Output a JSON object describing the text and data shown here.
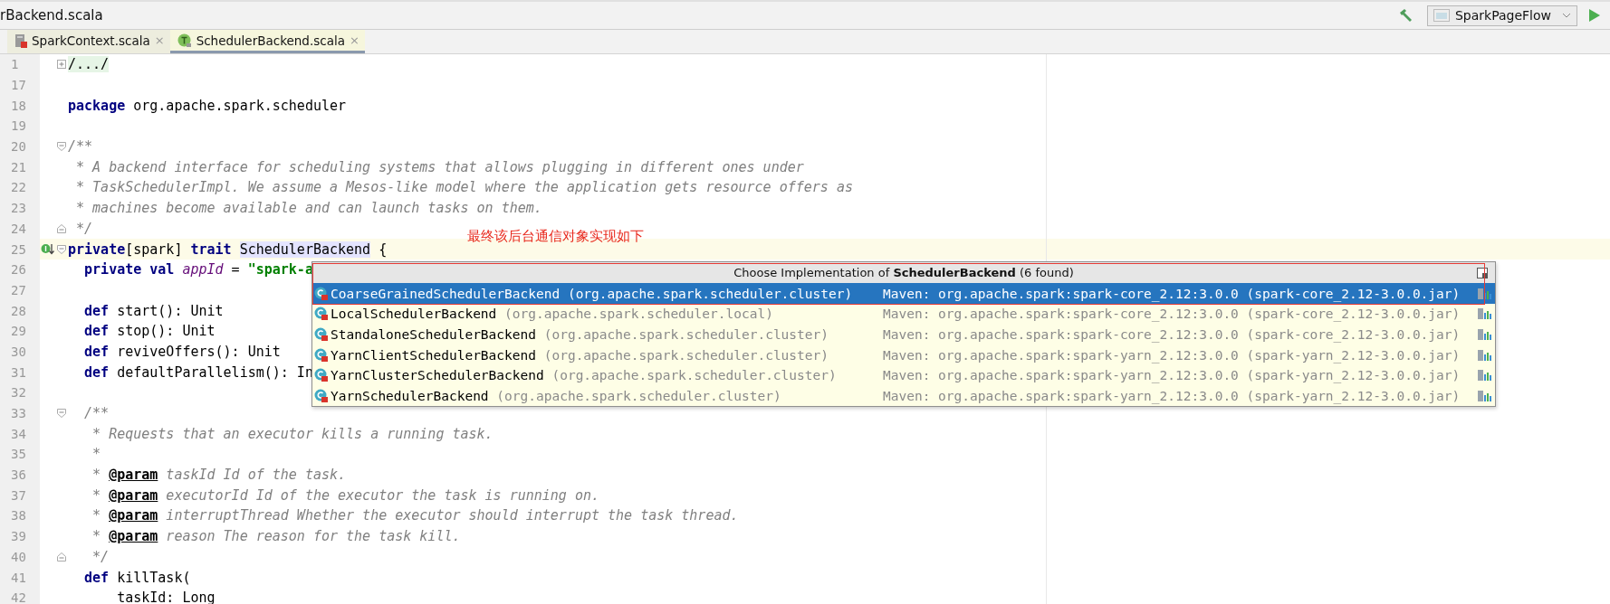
{
  "title_bar": {
    "title": "rBackend.scala",
    "run_config": "SparkPageFlow"
  },
  "tabs": [
    {
      "label": "SparkContext.scala",
      "close": "×",
      "kind": "scala",
      "selected": false
    },
    {
      "label": "SchedulerBackend.scala",
      "close": "×",
      "kind": "trait",
      "selected": true
    }
  ],
  "editor": {
    "lines": [
      {
        "number": "1",
        "current": false,
        "fold": {
          "kind": "collapsed"
        },
        "tokens": [
          {
            "kind": "folded",
            "text": "/.../"
          }
        ]
      },
      {
        "number": "17",
        "current": false
      },
      {
        "number": "18",
        "current": false,
        "tokens": [
          {
            "kind": "kw",
            "text": "package"
          },
          {
            "kind": "plain",
            "text": " org.apache.spark.scheduler"
          }
        ]
      },
      {
        "number": "19",
        "current": false
      },
      {
        "number": "20",
        "current": false,
        "fold": {
          "kind": "start"
        },
        "tokens": [
          {
            "kind": "comment",
            "text": "/**"
          }
        ]
      },
      {
        "number": "21",
        "current": false,
        "tokens": [
          {
            "kind": "comment",
            "text": " * A backend interface for scheduling systems that allows plugging in different ones under"
          }
        ]
      },
      {
        "number": "22",
        "current": false,
        "tokens": [
          {
            "kind": "comment",
            "text": " * TaskSchedulerImpl. We assume a Mesos-like model where the application gets resource offers as"
          }
        ]
      },
      {
        "number": "23",
        "current": false,
        "tokens": [
          {
            "kind": "comment",
            "text": " * machines become available and can launch tasks on them."
          }
        ]
      },
      {
        "number": "24",
        "current": false,
        "fold": {
          "kind": "end"
        },
        "tokens": [
          {
            "kind": "comment",
            "text": " */"
          }
        ]
      },
      {
        "number": "25",
        "current": true,
        "gutter": {
          "kind": "implemented"
        },
        "fold": {
          "kind": "start"
        },
        "tokens": [
          {
            "kind": "kw",
            "text": "private"
          },
          {
            "kind": "plain",
            "text": "[spark] "
          },
          {
            "kind": "kw",
            "text": "trait "
          },
          {
            "kind": "ref",
            "text": "SchedulerBackend"
          },
          {
            "kind": "plain",
            "text": " {"
          }
        ]
      },
      {
        "number": "26",
        "current": false,
        "tokens": [
          {
            "kind": "kw",
            "text": "  private val "
          },
          {
            "kind": "field",
            "text": "appId"
          },
          {
            "kind": "plain",
            "text": " = "
          },
          {
            "kind": "string",
            "text": "\"spark-a"
          }
        ]
      },
      {
        "number": "27",
        "current": false
      },
      {
        "number": "28",
        "current": false,
        "tokens": [
          {
            "kind": "kw",
            "text": "  def"
          },
          {
            "kind": "plain",
            "text": " start(): Unit"
          }
        ]
      },
      {
        "number": "29",
        "current": false,
        "tokens": [
          {
            "kind": "kw",
            "text": "  def"
          },
          {
            "kind": "plain",
            "text": " stop(): Unit"
          }
        ]
      },
      {
        "number": "30",
        "current": false,
        "tokens": [
          {
            "kind": "kw",
            "text": "  def"
          },
          {
            "kind": "plain",
            "text": " reviveOffers(): Unit"
          }
        ]
      },
      {
        "number": "31",
        "current": false,
        "tokens": [
          {
            "kind": "kw",
            "text": "  def"
          },
          {
            "kind": "plain",
            "text": " defaultParallelism(): In"
          }
        ]
      },
      {
        "number": "32",
        "current": false
      },
      {
        "number": "33",
        "current": false,
        "fold": {
          "kind": "start"
        },
        "tokens": [
          {
            "kind": "comment",
            "text": "  /**"
          }
        ]
      },
      {
        "number": "34",
        "current": false,
        "tokens": [
          {
            "kind": "comment",
            "text": "   * Requests that an executor kills a running task."
          }
        ]
      },
      {
        "number": "35",
        "current": false,
        "tokens": [
          {
            "kind": "comment",
            "text": "   *"
          }
        ]
      },
      {
        "number": "36",
        "current": false,
        "tokens": [
          {
            "kind": "comment",
            "text": "   * "
          },
          {
            "kind": "doctag",
            "text": "@param"
          },
          {
            "kind": "comment",
            "text": " taskId Id of the task."
          }
        ]
      },
      {
        "number": "37",
        "current": false,
        "tokens": [
          {
            "kind": "comment",
            "text": "   * "
          },
          {
            "kind": "doctag",
            "text": "@param"
          },
          {
            "kind": "comment",
            "text": " executorId Id of the executor the task is running on."
          }
        ]
      },
      {
        "number": "38",
        "current": false,
        "tokens": [
          {
            "kind": "comment",
            "text": "   * "
          },
          {
            "kind": "doctag",
            "text": "@param"
          },
          {
            "kind": "comment",
            "text": " interruptThread Whether the executor should interrupt the task thread."
          }
        ]
      },
      {
        "number": "39",
        "current": false,
        "tokens": [
          {
            "kind": "comment",
            "text": "   * "
          },
          {
            "kind": "doctag",
            "text": "@param"
          },
          {
            "kind": "comment",
            "text": " reason The reason for the task kill."
          }
        ]
      },
      {
        "number": "40",
        "current": false,
        "fold": {
          "kind": "end"
        },
        "tokens": [
          {
            "kind": "comment",
            "text": "   */"
          }
        ]
      },
      {
        "number": "41",
        "current": false,
        "tokens": [
          {
            "kind": "kw",
            "text": "  def"
          },
          {
            "kind": "plain",
            "text": " killTask("
          }
        ]
      },
      {
        "number": "42",
        "current": false,
        "tokens": [
          {
            "kind": "plain",
            "text": "      taskId: Long"
          }
        ]
      }
    ]
  },
  "annotation": {
    "text": "最终该后台通信对象实现如下"
  },
  "popup": {
    "title": "Choose Implementation of **SchedulerBackend** (6 found)",
    "items": [
      {
        "name": "CoarseGrainedSchedulerBackend",
        "package": "(org.apache.spark.scheduler.cluster)",
        "source": "Maven: org.apache.spark:spark-core_2.12:3.0.0 (spark-core_2.12-3.0.0.jar)",
        "selected": true
      },
      {
        "name": "LocalSchedulerBackend",
        "package": "(org.apache.spark.scheduler.local)",
        "source": "Maven: org.apache.spark:spark-core_2.12:3.0.0 (spark-core_2.12-3.0.0.jar)",
        "selected": false
      },
      {
        "name": "StandaloneSchedulerBackend",
        "package": "(org.apache.spark.scheduler.cluster)",
        "source": "Maven: org.apache.spark:spark-core_2.12:3.0.0 (spark-core_2.12-3.0.0.jar)",
        "selected": false
      },
      {
        "name": "YarnClientSchedulerBackend",
        "package": "(org.apache.spark.scheduler.cluster)",
        "source": "Maven: org.apache.spark:spark-yarn_2.12:3.0.0 (spark-yarn_2.12-3.0.0.jar)",
        "selected": false
      },
      {
        "name": "YarnClusterSchedulerBackend",
        "package": "(org.apache.spark.scheduler.cluster)",
        "source": "Maven: org.apache.spark:spark-yarn_2.12:3.0.0 (spark-yarn_2.12-3.0.0.jar)",
        "selected": false
      },
      {
        "name": "YarnSchedulerBackend",
        "package": "(org.apache.spark.scheduler.cluster)",
        "source": "Maven: org.apache.spark:spark-yarn_2.12:3.0.0 (spark-yarn_2.12-3.0.0.jar)",
        "selected": false
      }
    ]
  }
}
